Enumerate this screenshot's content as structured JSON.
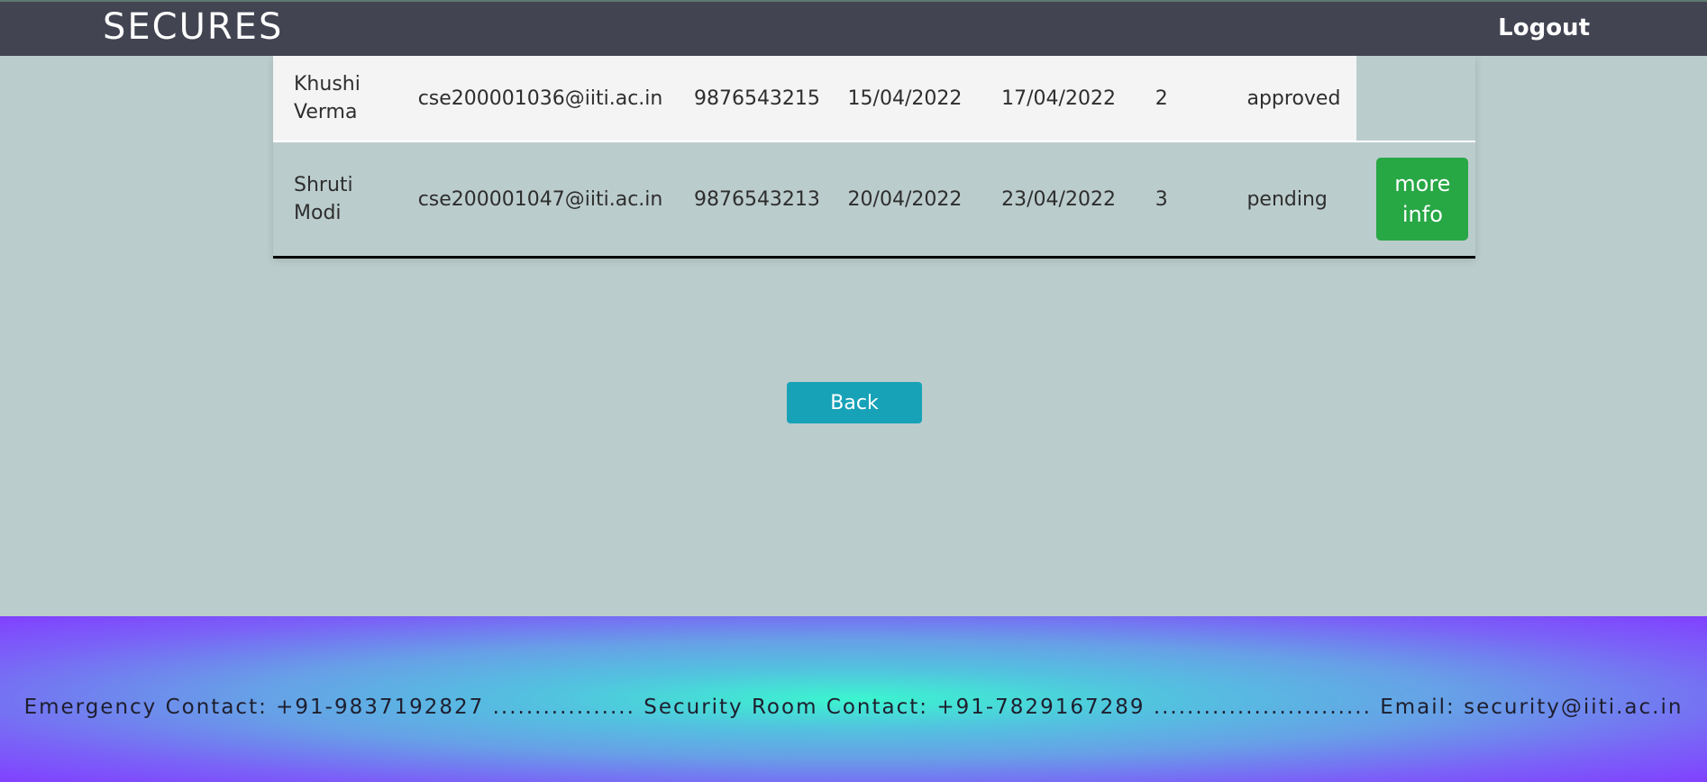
{
  "header": {
    "brand": "SECURES",
    "logout_label": "Logout"
  },
  "table": {
    "rows": [
      {
        "name": "Khushi Verma",
        "email": "cse200001036@iiti.ac.in",
        "phone": "9876543215",
        "from": "15/04/2022",
        "to": "17/04/2022",
        "days": "2",
        "status": "approved"
      },
      {
        "name": "Shruti Modi",
        "email": "cse200001047@iiti.ac.in",
        "phone": "9876543213",
        "from": "20/04/2022",
        "to": "23/04/2022",
        "days": "3",
        "status": "pending",
        "action_label": "more info"
      }
    ]
  },
  "back_label": "Back",
  "footer": {
    "text": "Emergency Contact: +91-9837192827 ................. Security Room Contact: +91-7829167289 .......................... Email: security@iiti.ac.in"
  },
  "colors": {
    "header_bg": "#424452",
    "page_bg": "#bbcccc",
    "more_info_button": "#28a745",
    "back_button": "#17a2b8"
  }
}
